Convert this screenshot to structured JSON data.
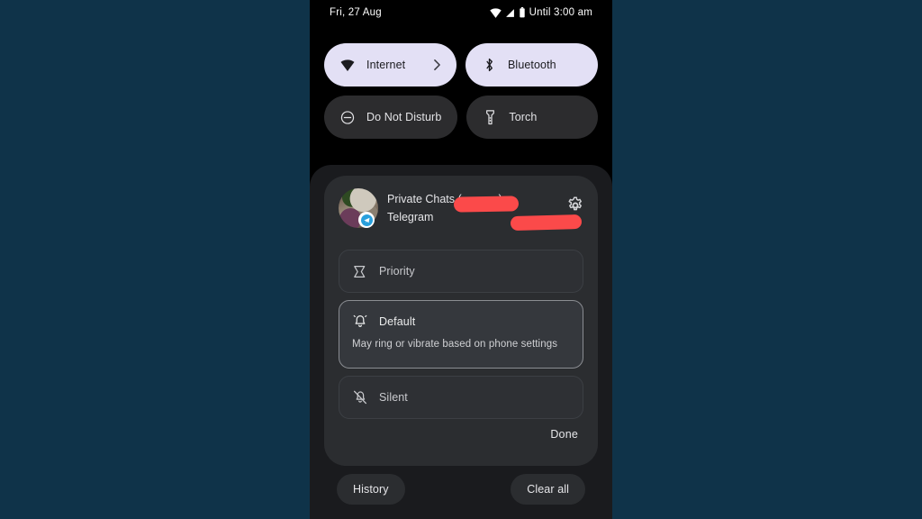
{
  "status_bar": {
    "date": "Fri, 27 Aug",
    "icons": [
      "wifi-icon",
      "signal-icon",
      "battery-icon"
    ],
    "dnd_status": "Until 3:00 am"
  },
  "quick_settings": {
    "tiles": [
      {
        "label": "Internet",
        "icon": "wifi-icon",
        "state": "on",
        "has_chevron": true
      },
      {
        "label": "Bluetooth",
        "icon": "bluetooth-icon",
        "state": "on",
        "has_chevron": false
      },
      {
        "label": "Do Not Disturb",
        "icon": "dnd-icon",
        "state": "off",
        "has_chevron": false
      },
      {
        "label": "Torch",
        "icon": "flashlight-icon",
        "state": "off",
        "has_chevron": false
      }
    ]
  },
  "notification": {
    "channel_title": "Private Chats (",
    "channel_title_end": "x)",
    "app_name": "Telegram",
    "settings_icon": "gear-icon",
    "avatar_badge": "telegram-icon",
    "redactions": 2,
    "options": [
      {
        "id": "priority",
        "label": "Priority",
        "icon": "priority-flag-icon",
        "description": "",
        "selected": false
      },
      {
        "id": "default",
        "label": "Default",
        "icon": "bell-ring-icon",
        "description": "May ring or vibrate based on phone settings",
        "selected": true
      },
      {
        "id": "silent",
        "label": "Silent",
        "icon": "bell-off-icon",
        "description": "",
        "selected": false
      }
    ],
    "done_label": "Done"
  },
  "shade_footer": {
    "history_label": "History",
    "clear_all_label": "Clear all"
  },
  "colors": {
    "backdrop": "#0f3349",
    "phone_bg": "#000000",
    "shade_bg": "#1a1b1e",
    "card_bg": "#2b2d30",
    "tile_on": "#e3e0f5",
    "tile_off": "#2c2c2e",
    "selected_border": "#8a8d92",
    "redaction": "#fb4a4a",
    "telegram_blue": "#29a0dd"
  }
}
